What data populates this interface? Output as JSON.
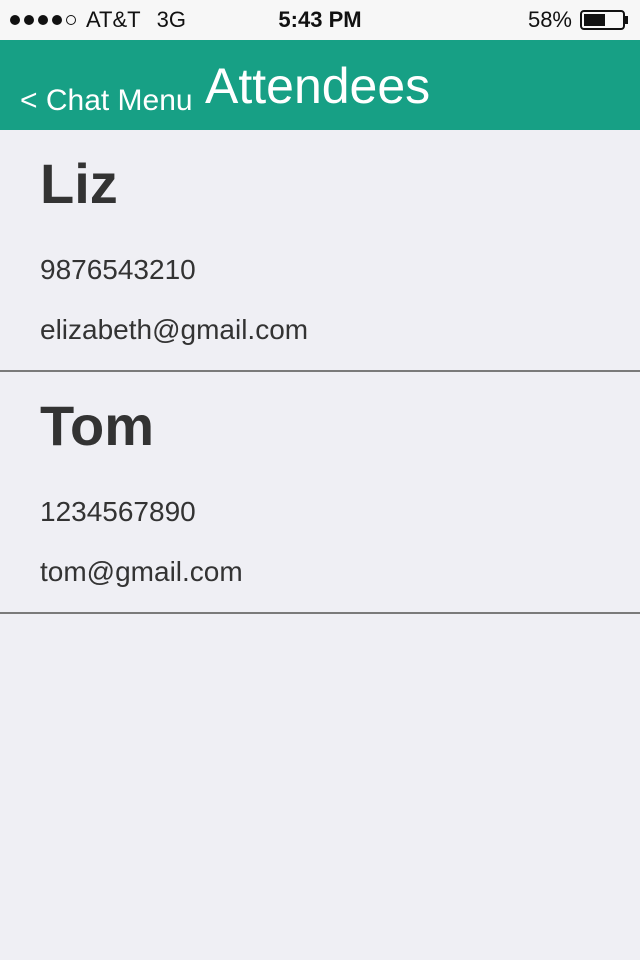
{
  "status_bar": {
    "carrier": "AT&T",
    "network": "3G",
    "time": "5:43 PM",
    "battery_percent": "58%",
    "signal_bars_filled": 4,
    "signal_bars_total": 5,
    "battery_level": 0.58
  },
  "nav": {
    "back_label": "< Chat Menu",
    "title": "Attendees",
    "bar_color": "#17A085"
  },
  "attendees": [
    {
      "name": "Liz",
      "phone": "9876543210",
      "email": "elizabeth@gmail.com"
    },
    {
      "name": "Tom",
      "phone": "1234567890",
      "email": "tom@gmail.com"
    }
  ],
  "icons": {
    "signal": "signal-strength-icon",
    "battery": "battery-icon"
  }
}
